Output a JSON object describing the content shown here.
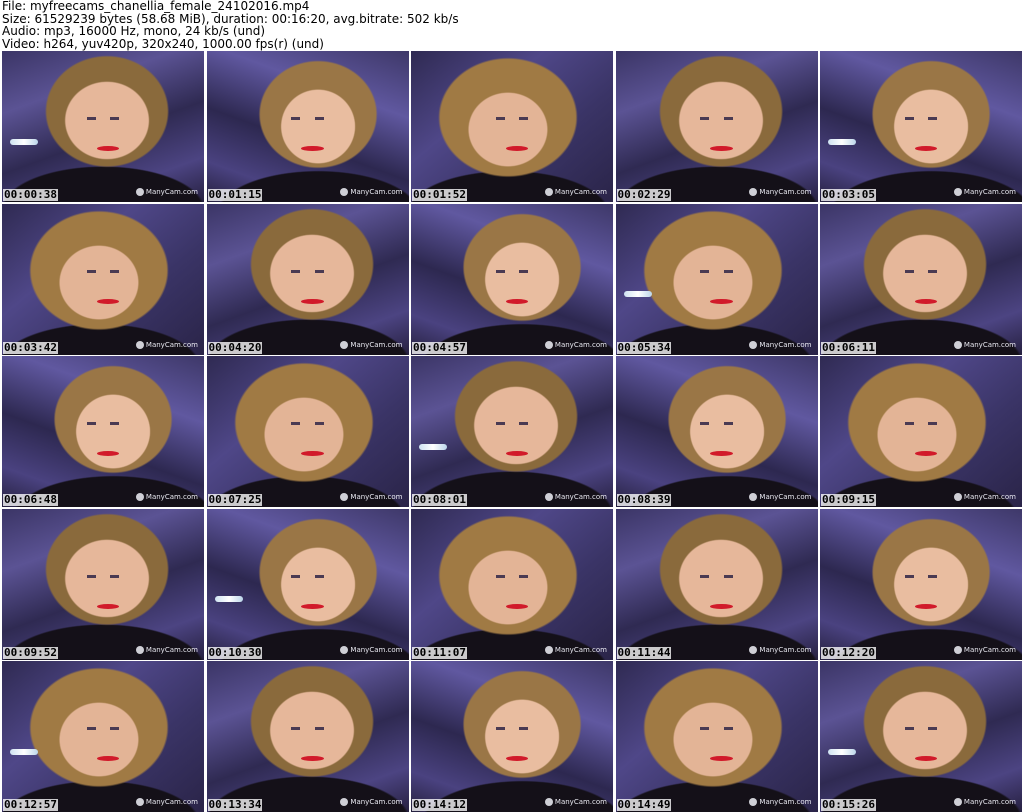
{
  "header": {
    "file": "File: myfreecams_chanellia_female_24102016.mp4",
    "size": "Size: 61529239 bytes (58.68 MiB), duration: 00:16:20, avg.bitrate: 502 kb/s",
    "audio": "Audio: mp3, 16000 Hz, mono, 24 kb/s (und)",
    "video": "Video: h264, yuv420p, 320x240, 1000.00 fps(r) (und)"
  },
  "watermark": "ManyCam.com",
  "thumbnails": [
    {
      "ts": "00:00:38"
    },
    {
      "ts": "00:01:15"
    },
    {
      "ts": "00:01:52"
    },
    {
      "ts": "00:02:29"
    },
    {
      "ts": "00:03:05"
    },
    {
      "ts": "00:03:42"
    },
    {
      "ts": "00:04:20"
    },
    {
      "ts": "00:04:57"
    },
    {
      "ts": "00:05:34"
    },
    {
      "ts": "00:06:11"
    },
    {
      "ts": "00:06:48"
    },
    {
      "ts": "00:07:25"
    },
    {
      "ts": "00:08:01"
    },
    {
      "ts": "00:08:39"
    },
    {
      "ts": "00:09:15"
    },
    {
      "ts": "00:09:52"
    },
    {
      "ts": "00:10:30"
    },
    {
      "ts": "00:11:07"
    },
    {
      "ts": "00:11:44"
    },
    {
      "ts": "00:12:20"
    },
    {
      "ts": "00:12:57"
    },
    {
      "ts": "00:13:34"
    },
    {
      "ts": "00:14:12"
    },
    {
      "ts": "00:14:49"
    },
    {
      "ts": "00:15:26"
    }
  ]
}
